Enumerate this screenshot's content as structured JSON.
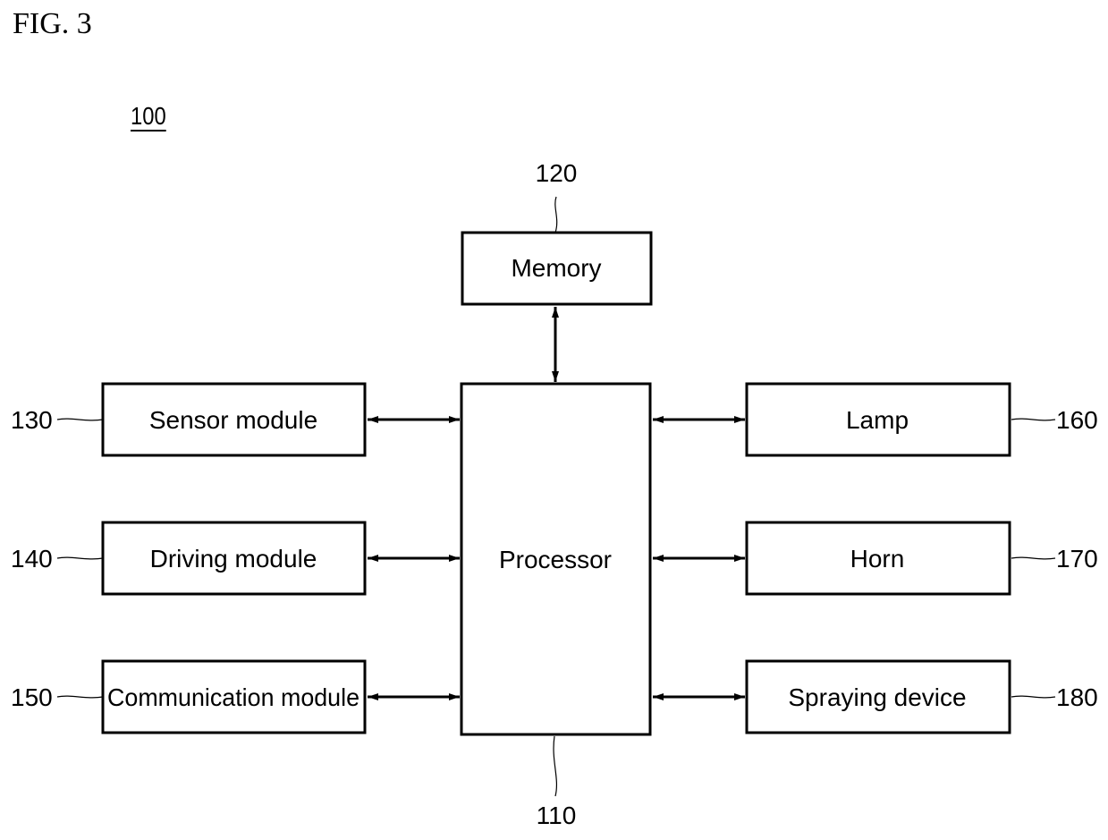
{
  "figure": {
    "title": "FIG. 3",
    "system_ref": "100"
  },
  "blocks": {
    "processor": {
      "label": "Processor",
      "ref": "110"
    },
    "memory": {
      "label": "Memory",
      "ref": "120"
    },
    "sensor": {
      "label": "Sensor module",
      "ref": "130"
    },
    "driving": {
      "label": "Driving module",
      "ref": "140"
    },
    "communication": {
      "label": "Communication module",
      "ref": "150"
    },
    "lamp": {
      "label": "Lamp",
      "ref": "160"
    },
    "horn": {
      "label": "Horn",
      "ref": "170"
    },
    "spraying": {
      "label": "Spraying device",
      "ref": "180"
    }
  },
  "connections": [
    {
      "from": "memory",
      "to": "processor",
      "direction": "bidirectional"
    },
    {
      "from": "sensor",
      "to": "processor",
      "direction": "bidirectional"
    },
    {
      "from": "driving",
      "to": "processor",
      "direction": "bidirectional"
    },
    {
      "from": "communication",
      "to": "processor",
      "direction": "bidirectional"
    },
    {
      "from": "lamp",
      "to": "processor",
      "direction": "bidirectional"
    },
    {
      "from": "horn",
      "to": "processor",
      "direction": "bidirectional"
    },
    {
      "from": "spraying",
      "to": "processor",
      "direction": "bidirectional"
    }
  ]
}
